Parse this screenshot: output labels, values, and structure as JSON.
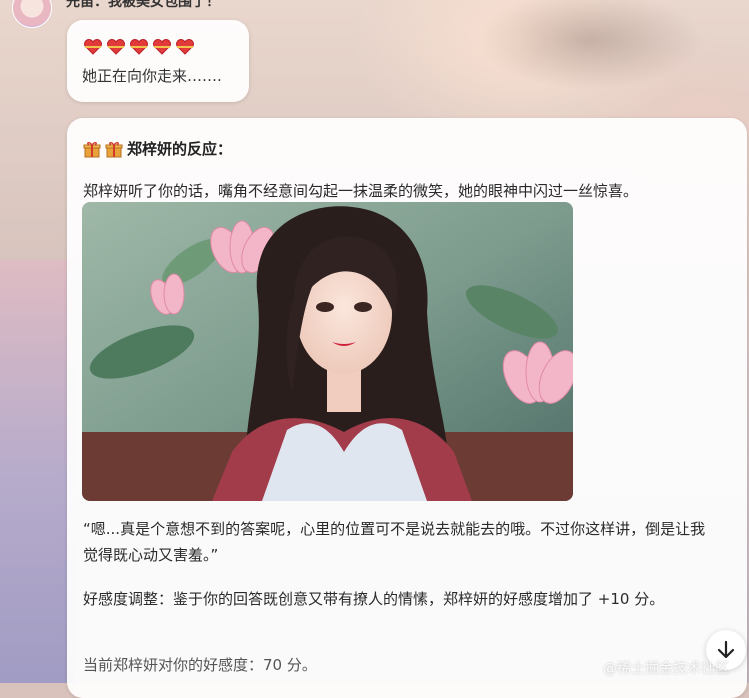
{
  "header": {
    "sender_text": "先笛：我被美女包围了！"
  },
  "message1": {
    "heart_icons": [
      "heart-icon",
      "heart-icon",
      "heart-icon",
      "heart-icon",
      "heart-icon"
    ],
    "text": "她正在向你走来……."
  },
  "message2": {
    "title": "郑梓妍的反应：",
    "para1": "郑梓妍听了你的话，嘴角不经意间勾起一抹温柔的微笑，她的眼神中闪过一丝惊喜。",
    "para2": "“嗯...真是个意想不到的答案呢，心里的位置可不是说去就能去的哦。不过你这样讲，倒是让我觉得既心动又害羞。”",
    "para3": "好感度调整：鉴于你的回答既创意又带有撩人的情愫，郑梓妍的好感度增加了 +10 分。",
    "para4": "当前郑梓妍对你的好感度：70 分。"
  },
  "watermark": "@稀土掘金技术社区",
  "colors": {
    "heart": "#e23a3a",
    "gift": "#e8a23a",
    "bubble": "#ffffff"
  }
}
